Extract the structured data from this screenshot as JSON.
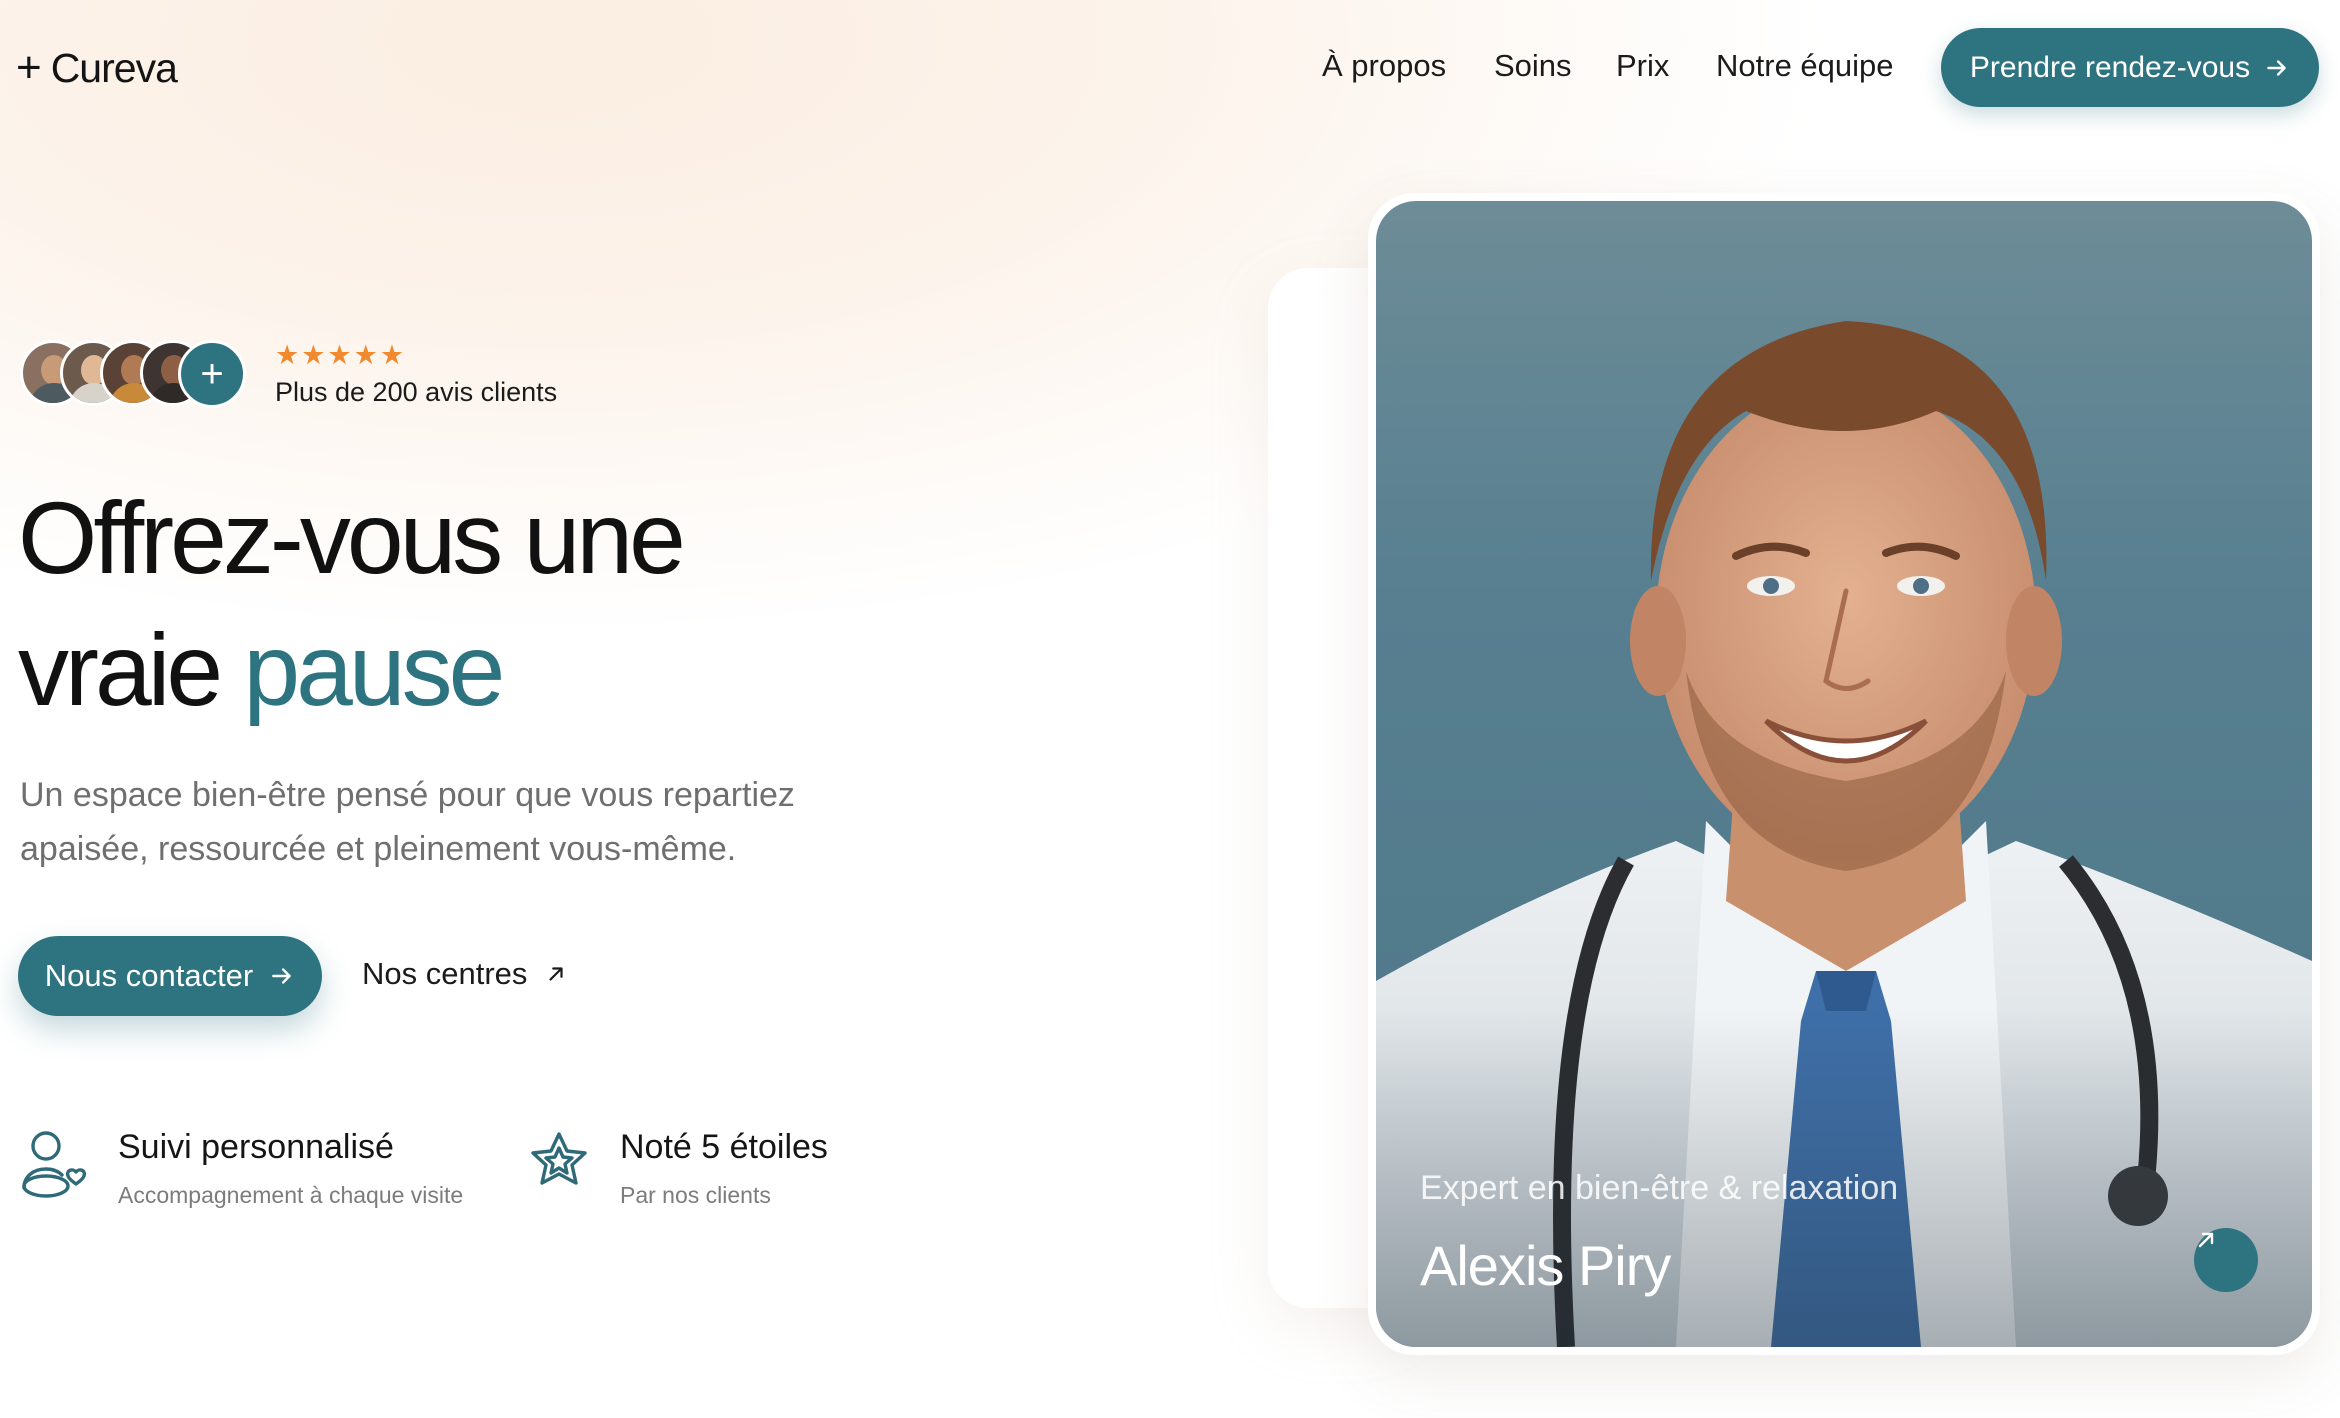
{
  "brand": {
    "name": "Cureva"
  },
  "nav": {
    "links": [
      "À propos",
      "Soins",
      "Prix",
      "Notre équipe"
    ],
    "cta_label": "Prendre rendez-vous"
  },
  "reviews": {
    "rating": 5,
    "stars": "★★★★★",
    "text": "Plus de 200 avis clients"
  },
  "hero": {
    "title_line1": "Offrez-vous une",
    "title_line2_plain": "vraie ",
    "title_line2_accent": "pause",
    "subtitle_line1": "Un espace bien-être pensé pour que vous repartiez",
    "subtitle_line2": "apaisée, ressourcée et pleinement vous-même.",
    "primary_cta": "Nous contacter",
    "secondary_cta": "Nos centres"
  },
  "features": [
    {
      "icon": "user-heart-icon",
      "title": "Suivi personnalisé",
      "subtitle": "Accompagnement à chaque visite"
    },
    {
      "icon": "star-outline-icon",
      "title": "Noté 5 étoiles",
      "subtitle": "Par nos clients"
    }
  ],
  "profile_card": {
    "role": "Expert en bien-être & relaxation",
    "name": "Alexis Piry"
  },
  "colors": {
    "accent": "#2e7380",
    "star": "#f08a2c",
    "background_warm": "#fbeee2",
    "text": "#141414",
    "muted": "#6f6f6f"
  }
}
